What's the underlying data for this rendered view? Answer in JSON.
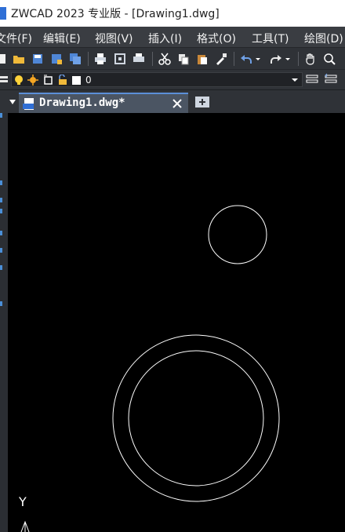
{
  "window": {
    "title": "ZWCAD 2023 专业版 - [Drawing1.dwg]"
  },
  "menu": [
    {
      "label": "文件(F)"
    },
    {
      "label": "编辑(E)"
    },
    {
      "label": "视图(V)"
    },
    {
      "label": "插入(I)"
    },
    {
      "label": "格式(O)"
    },
    {
      "label": "工具(T)"
    },
    {
      "label": "绘图(D)"
    }
  ],
  "layer_toolbar": {
    "current_layer": "0"
  },
  "tabs": [
    {
      "label": "Drawing1.dwg*"
    }
  ],
  "ucs": {
    "y_label": "Y"
  },
  "colors": {
    "accent": "#5b8fd8",
    "canvas": "#000000",
    "chrome": "#2f3237"
  }
}
